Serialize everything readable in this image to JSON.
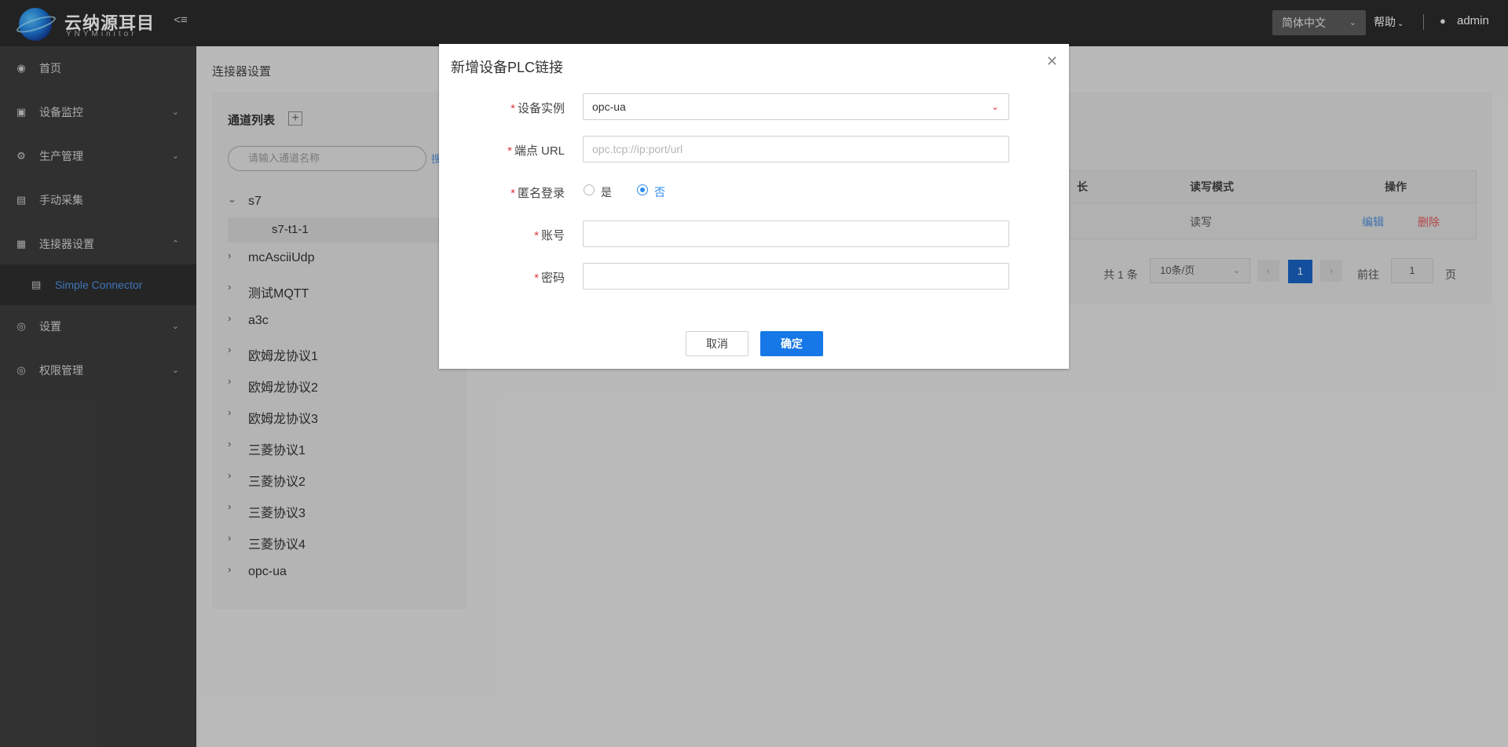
{
  "header": {
    "logo_title": "云纳源耳目",
    "logo_subtitle": "YNYMinitor",
    "language": "简体中文",
    "help": "帮助",
    "user": "admin"
  },
  "sidebar": {
    "items": [
      {
        "label": "首页",
        "icon": "dashboard-icon"
      },
      {
        "label": "设备监控",
        "icon": "monitor-icon"
      },
      {
        "label": "生产管理",
        "icon": "gear-icon"
      },
      {
        "label": "手动采集",
        "icon": "screen-icon"
      },
      {
        "label": "连接器设置",
        "icon": "book-icon"
      },
      {
        "label": "设置",
        "icon": "settings-icon"
      },
      {
        "label": "权限管理",
        "icon": "shield-icon"
      }
    ],
    "subitem": {
      "label": "Simple Connector",
      "icon": "server-icon"
    }
  },
  "main": {
    "page_title": "连接器设置",
    "channel_panel": {
      "title": "通道列表",
      "search_placeholder": "请输入通道名称",
      "search_link": "搜",
      "tree": [
        {
          "label": "s7",
          "expanded": true,
          "children": [
            "s7-t1-1"
          ]
        },
        {
          "label": "mcAsciiUdp"
        },
        {
          "label": "测试MQTT"
        },
        {
          "label": "a3c"
        },
        {
          "label": "欧姆龙协议1"
        },
        {
          "label": "欧姆龙协议2"
        },
        {
          "label": "欧姆龙协议3"
        },
        {
          "label": "三菱协议1"
        },
        {
          "label": "三菱协议2"
        },
        {
          "label": "三菱协议3"
        },
        {
          "label": "三菱协议4"
        },
        {
          "label": "opc-ua"
        }
      ]
    },
    "table": {
      "headers": [
        "长",
        "读写模式",
        "操作"
      ],
      "rows": [
        {
          "mode": "读写",
          "edit": "编辑",
          "delete": "删除"
        }
      ]
    },
    "pager": {
      "total": "共 1 条",
      "page_size": "10条/页",
      "current_page": "1",
      "goto_label": "前往",
      "goto_value": "1",
      "page_suffix": "页"
    }
  },
  "dialog": {
    "title": "新增设备PLC链接",
    "fields": {
      "device": {
        "label": "设备实例",
        "value": "opc-ua"
      },
      "endpoint": {
        "label": "端点 URL",
        "placeholder": "opc.tcp://ip:port/url"
      },
      "anonymous": {
        "label": "匿名登录",
        "options": [
          "是",
          "否"
        ],
        "selected": "否"
      },
      "account": {
        "label": "账号",
        "value": ""
      },
      "password": {
        "label": "密码",
        "value": ""
      }
    },
    "cancel": "取消",
    "confirm": "确定"
  },
  "colors": {
    "primary": "#1677e6",
    "link": "#4f8fdc",
    "danger": "#e05a5a",
    "required": "#e0383e"
  }
}
